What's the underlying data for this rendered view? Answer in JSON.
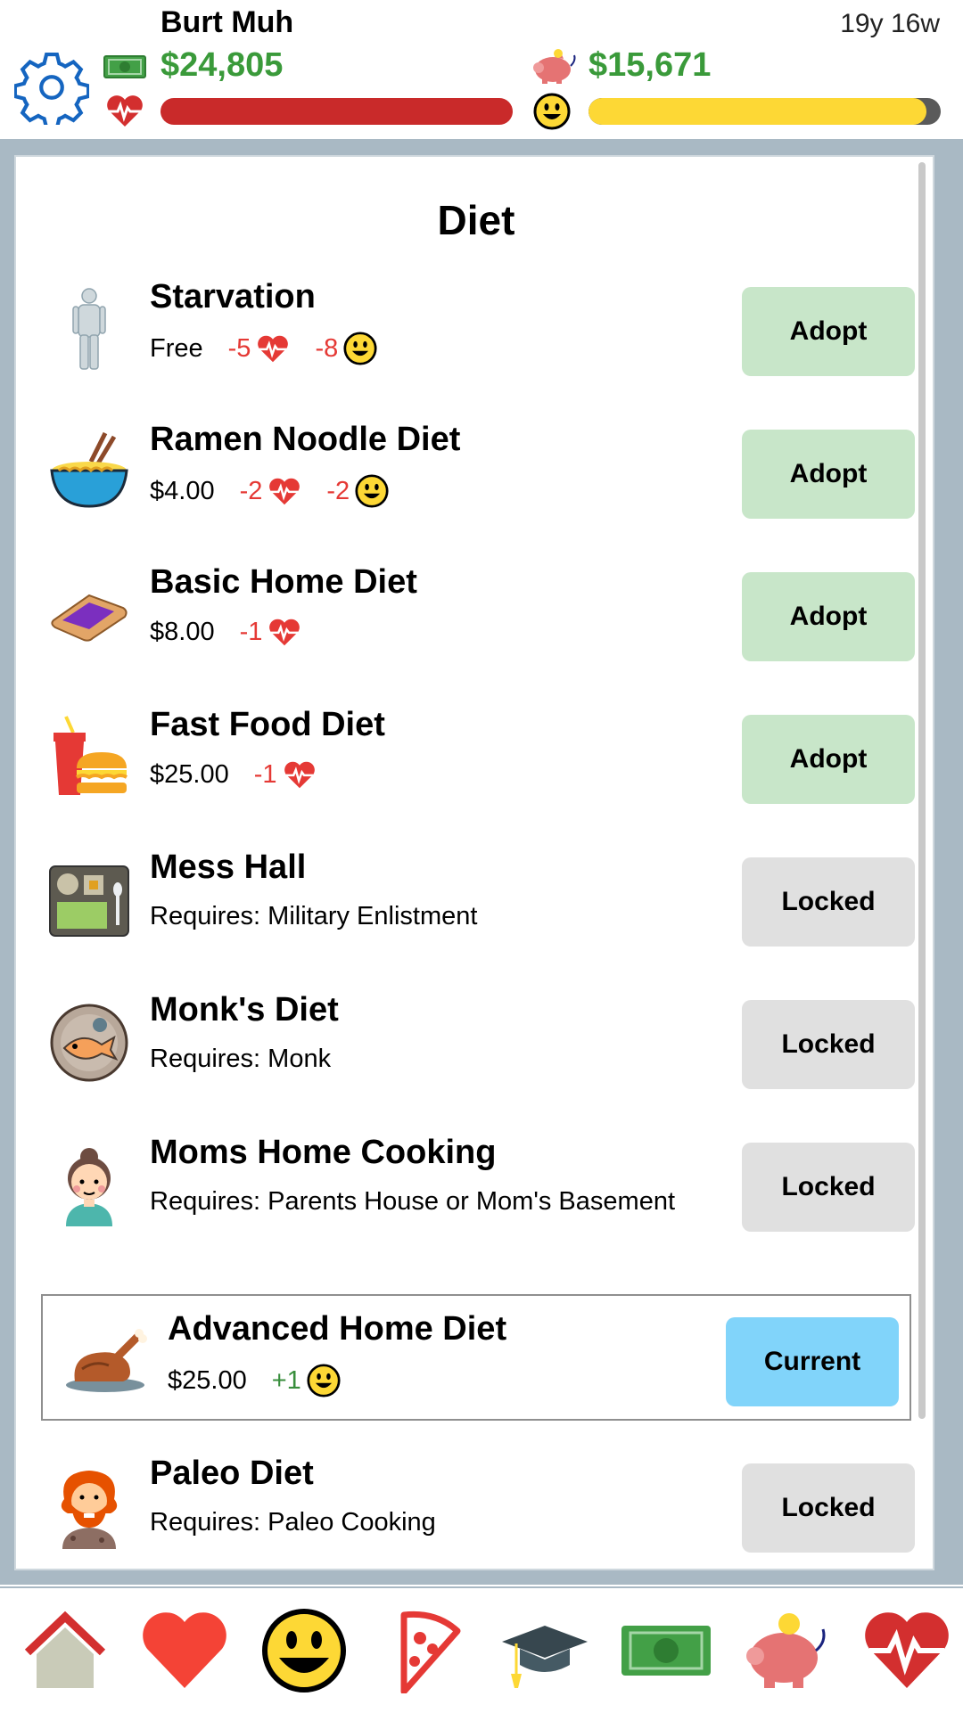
{
  "header": {
    "character_name": "Burt Muh",
    "age": "19y 16w",
    "cash": "$24,805",
    "bank": "$15,671",
    "health_level": 1.0,
    "happiness_level": 0.96
  },
  "page": {
    "title": "Diet"
  },
  "diets": [
    {
      "name": "Starvation",
      "icon": "person-silhouette-icon",
      "price": "Free",
      "health": "-5",
      "happiness": "-8",
      "button": "Adopt"
    },
    {
      "name": "Ramen Noodle Diet",
      "icon": "ramen-bowl-icon",
      "price": "$4.00",
      "health": "-2",
      "happiness": "-2",
      "button": "Adopt"
    },
    {
      "name": "Basic Home Diet",
      "icon": "toast-jam-icon",
      "price": "$8.00",
      "health": "-1",
      "button": "Adopt"
    },
    {
      "name": "Fast Food Diet",
      "icon": "burger-soda-icon",
      "price": "$25.00",
      "health": "-1",
      "button": "Adopt"
    },
    {
      "name": "Mess Hall",
      "icon": "meal-tray-icon",
      "requires": "Requires: Military Enlistment",
      "button": "Locked"
    },
    {
      "name": "Monk's Diet",
      "icon": "fish-plate-icon",
      "requires": "Requires: Monk",
      "button": "Locked"
    },
    {
      "name": "Moms Home Cooking",
      "icon": "mom-icon",
      "requires": "Requires: Parents House or Mom's Basement",
      "button": "Locked"
    },
    {
      "name": "Advanced Home Diet",
      "icon": "roast-turkey-icon",
      "price": "$25.00",
      "happiness": "+1",
      "button": "Current"
    },
    {
      "name": "Paleo Diet",
      "icon": "caveman-icon",
      "requires": "Requires: Paleo Cooking",
      "button": "Locked"
    }
  ],
  "nav": [
    "home-icon",
    "heart-icon",
    "smiley-icon",
    "pizza-icon",
    "graduation-cap-icon",
    "money-icon",
    "piggy-bank-icon",
    "heart-pulse-icon"
  ],
  "colors": {
    "adopt": "#c8e6c9",
    "locked": "#e0e0e0",
    "current": "#81d4fa",
    "health_bar": "#c92a2a",
    "happy_bar": "#fdd835",
    "money": "#3a9a3a"
  }
}
